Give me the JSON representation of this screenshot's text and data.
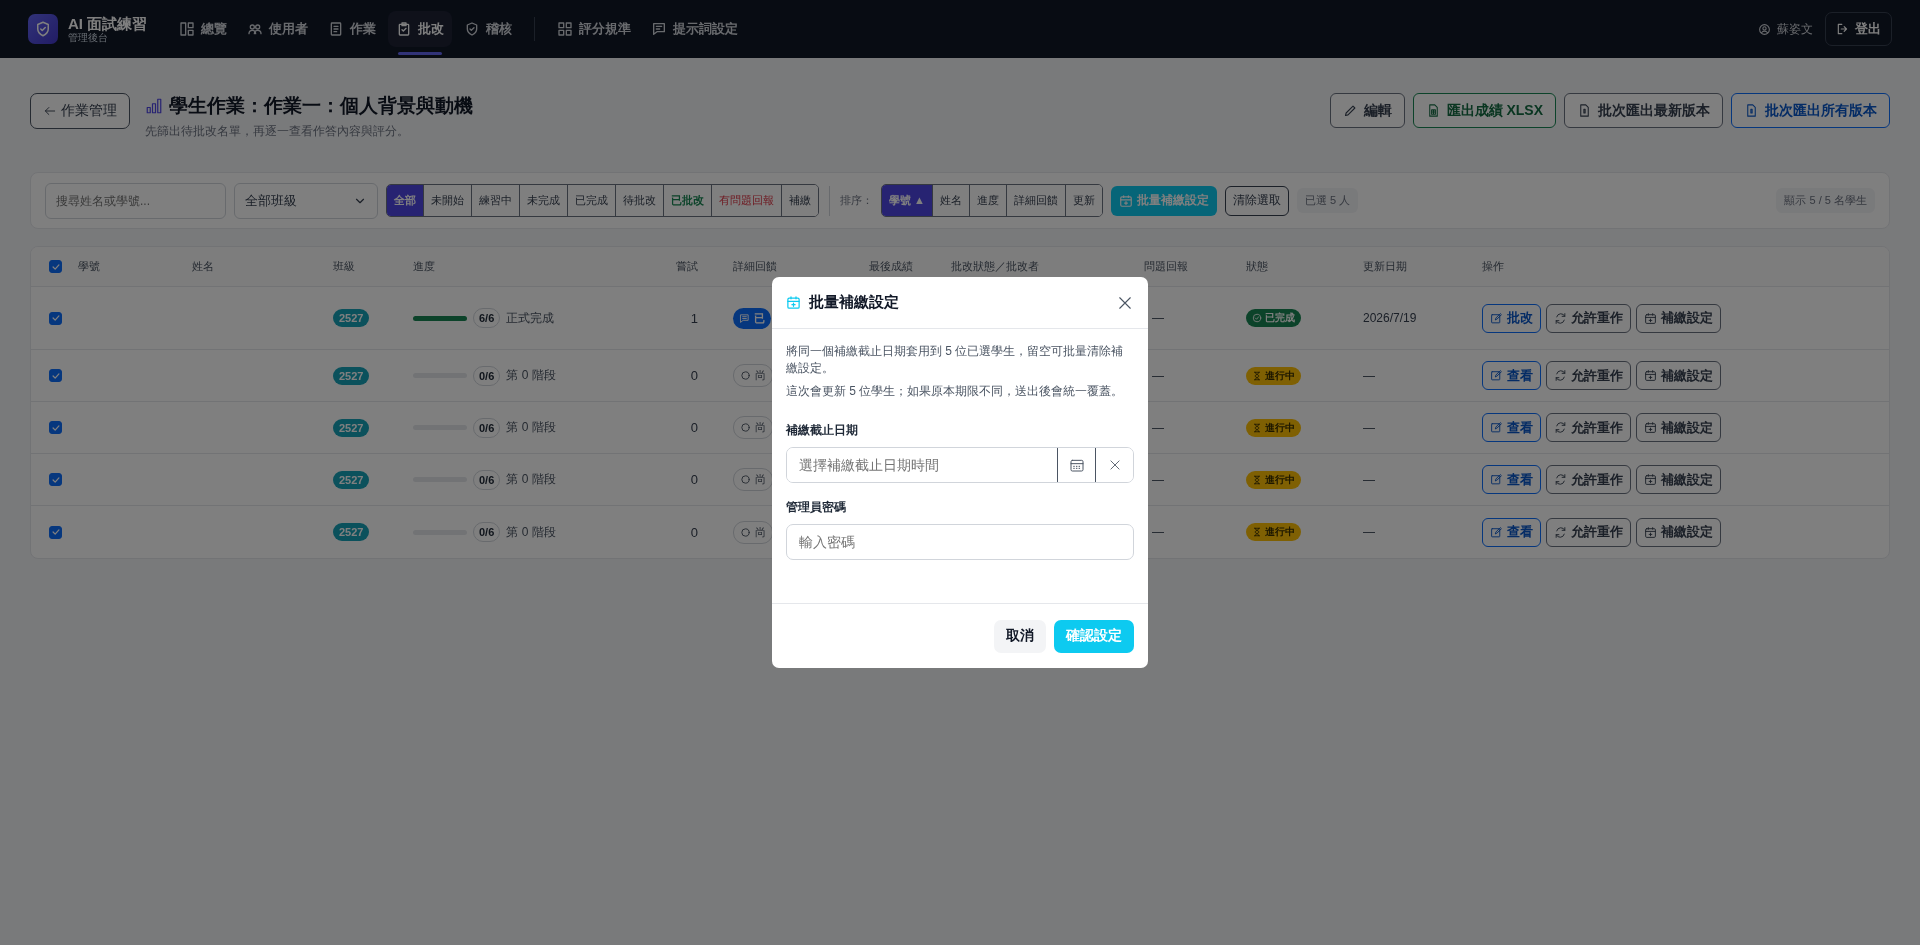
{
  "app": {
    "title": "AI 面試練習",
    "subtitle": "管理後台"
  },
  "nav_groups": [
    {
      "items": [
        {
          "label": "總覽",
          "selected": false
        },
        {
          "label": "使用者",
          "selected": false
        },
        {
          "label": "作業",
          "selected": false
        },
        {
          "label": "批改",
          "selected": true
        },
        {
          "label": "稽核",
          "selected": false
        }
      ]
    },
    {
      "items": [
        {
          "label": "評分規準",
          "selected": false
        },
        {
          "label": "提示詞設定",
          "selected": false
        }
      ]
    }
  ],
  "user": {
    "name": "蘇姿文"
  },
  "logout": "登出",
  "page": {
    "back": "作業管理",
    "title": "學生作業：作業一：個人背景與動機",
    "subtitle": "先篩出待批改名單，再逐一查看作答內容與評分。",
    "actions": [
      {
        "label": "編輯",
        "kind": "default"
      },
      {
        "label": "匯出成績 XLSX",
        "kind": "success"
      },
      {
        "label": "批次匯出最新版本",
        "kind": "default"
      },
      {
        "label": "批次匯出所有版本",
        "kind": "primary"
      }
    ]
  },
  "filters": {
    "search_placeholder": "搜尋姓名或學號...",
    "class_select": "全部班級",
    "statuses": [
      {
        "label": "全部",
        "selected": true,
        "kind": "default"
      },
      {
        "label": "未開始",
        "selected": false,
        "kind": "default"
      },
      {
        "label": "練習中",
        "selected": false,
        "kind": "default"
      },
      {
        "label": "未完成",
        "selected": false,
        "kind": "default"
      },
      {
        "label": "已完成",
        "selected": false,
        "kind": "default"
      },
      {
        "label": "待批改",
        "selected": false,
        "kind": "default"
      },
      {
        "label": "已批改",
        "selected": false,
        "kind": "success"
      },
      {
        "label": "有問題回報",
        "selected": false,
        "kind": "danger"
      },
      {
        "label": "補繳",
        "selected": false,
        "kind": "default"
      }
    ],
    "sort_label": "排序：",
    "sorts": [
      {
        "label": "學號",
        "selected": true,
        "arrow": "▲"
      },
      {
        "label": "姓名",
        "selected": false
      },
      {
        "label": "進度",
        "selected": false
      },
      {
        "label": "詳細回饋",
        "selected": false
      },
      {
        "label": "更新",
        "selected": false
      }
    ],
    "bulk_button": "批量補繳設定",
    "clear_button": "清除選取",
    "selected_count": "已選 5 人",
    "shown_count": "顯示 5 / 5 名學生"
  },
  "table": {
    "all_checked": true,
    "columns": [
      "學號",
      "姓名",
      "班級",
      "進度",
      "嘗試",
      "詳細回饋",
      "最後成績",
      "批改狀態／批改者",
      "問題回報",
      "狀態",
      "更新日期",
      "操作"
    ],
    "rows": [
      {
        "checked": true,
        "class": "2527",
        "progress": {
          "level": 1,
          "text": "6/6",
          "stage": "正式完成"
        },
        "attempts": "1",
        "feedback": {
          "kind": "generated",
          "label": "已"
        },
        "issue": "—",
        "status": {
          "kind": "done",
          "label": "已完成"
        },
        "updated": "2026/7/19",
        "actions": [
          {
            "label": "批改",
            "kind": "primary"
          },
          {
            "label": "允許重作",
            "kind": "retry"
          },
          {
            "label": "補繳設定",
            "kind": "makeup"
          }
        ]
      },
      {
        "checked": true,
        "class": "2527",
        "progress": {
          "level": 0,
          "text": "0/6",
          "stage": "第 0 階段"
        },
        "attempts": "0",
        "feedback": {
          "kind": "none",
          "label": "尚"
        },
        "issue": "—",
        "status": {
          "kind": "in_progress",
          "label": "進行中"
        },
        "updated": "—",
        "actions": [
          {
            "label": "查看",
            "kind": "primary"
          },
          {
            "label": "允許重作",
            "kind": "retry"
          },
          {
            "label": "補繳設定",
            "kind": "makeup"
          }
        ]
      },
      {
        "checked": true,
        "class": "2527",
        "progress": {
          "level": 0,
          "text": "0/6",
          "stage": "第 0 階段"
        },
        "attempts": "0",
        "feedback": {
          "kind": "none",
          "label": "尚"
        },
        "issue": "—",
        "status": {
          "kind": "in_progress",
          "label": "進行中"
        },
        "updated": "—",
        "actions": [
          {
            "label": "查看",
            "kind": "primary"
          },
          {
            "label": "允許重作",
            "kind": "retry"
          },
          {
            "label": "補繳設定",
            "kind": "makeup"
          }
        ]
      },
      {
        "checked": true,
        "class": "2527",
        "progress": {
          "level": 0,
          "text": "0/6",
          "stage": "第 0 階段"
        },
        "attempts": "0",
        "feedback": {
          "kind": "none",
          "label": "尚"
        },
        "issue": "—",
        "status": {
          "kind": "in_progress",
          "label": "進行中"
        },
        "updated": "—",
        "actions": [
          {
            "label": "查看",
            "kind": "primary"
          },
          {
            "label": "允許重作",
            "kind": "retry"
          },
          {
            "label": "補繳設定",
            "kind": "makeup"
          }
        ]
      },
      {
        "checked": true,
        "class": "2527",
        "progress": {
          "level": 0,
          "text": "0/6",
          "stage": "第 0 階段"
        },
        "attempts": "0",
        "feedback": {
          "kind": "none",
          "label": "尚"
        },
        "issue": "—",
        "status": {
          "kind": "in_progress",
          "label": "進行中"
        },
        "updated": "—",
        "actions": [
          {
            "label": "查看",
            "kind": "primary"
          },
          {
            "label": "允許重作",
            "kind": "retry"
          },
          {
            "label": "補繳設定",
            "kind": "makeup"
          }
        ]
      }
    ]
  },
  "modal": {
    "title": "批量補繳設定",
    "paragraphs": [
      "將同一個補繳截止日期套用到 5 位已選學生，留空可批量清除補繳設定。",
      "這次會更新 5 位學生；如果原本期限不同，送出後會統一覆蓋。"
    ],
    "fields": [
      {
        "kind": "date",
        "label": "補繳截止日期",
        "placeholder": "選擇補繳截止日期時間"
      },
      {
        "kind": "password",
        "label": "管理員密碼",
        "placeholder": "輸入密碼"
      }
    ],
    "buttons": [
      {
        "label": "取消",
        "kind": "secondary"
      },
      {
        "label": "確認設定",
        "kind": "primary"
      }
    ]
  }
}
